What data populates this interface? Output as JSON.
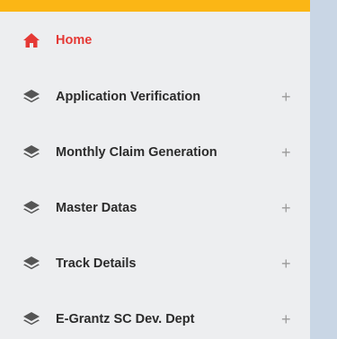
{
  "colors": {
    "accent": "#fbb615",
    "active": "#e53935",
    "icon": "#555555",
    "sidebar_bg": "#edeef0",
    "content_bg": "#c9d6e5"
  },
  "sidebar": {
    "items": [
      {
        "label": "Home",
        "icon": "home-icon",
        "active": true,
        "expandable": false
      },
      {
        "label": "Application Verification",
        "icon": "layers-icon",
        "active": false,
        "expandable": true,
        "expand_symbol": "+"
      },
      {
        "label": "Monthly Claim Generation",
        "icon": "layers-icon",
        "active": false,
        "expandable": true,
        "expand_symbol": "+"
      },
      {
        "label": "Master Datas",
        "icon": "layers-icon",
        "active": false,
        "expandable": true,
        "expand_symbol": "+"
      },
      {
        "label": "Track Details",
        "icon": "layers-icon",
        "active": false,
        "expandable": true,
        "expand_symbol": "+"
      },
      {
        "label": "E-Grantz SC Dev. Dept",
        "icon": "layers-icon",
        "active": false,
        "expandable": true,
        "expand_symbol": "+"
      }
    ]
  }
}
